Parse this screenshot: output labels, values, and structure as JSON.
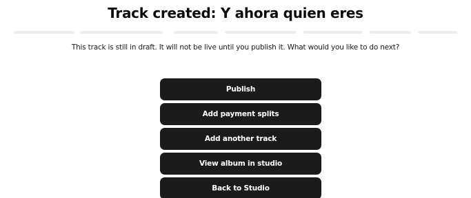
{
  "dialog": {
    "title": "Track created: Y ahora quien eres",
    "message": "This track is still in draft. It will not be live until you publish it. What would you like to do next?"
  },
  "actions": [
    {
      "label": "Publish"
    },
    {
      "label": "Add payment splits"
    },
    {
      "label": "Add another track"
    },
    {
      "label": "View album in studio"
    },
    {
      "label": "Back to Studio"
    }
  ],
  "colors": {
    "button_background": "#1b1b1b",
    "button_text": "#ffffff",
    "page_background": "#ffffff"
  }
}
